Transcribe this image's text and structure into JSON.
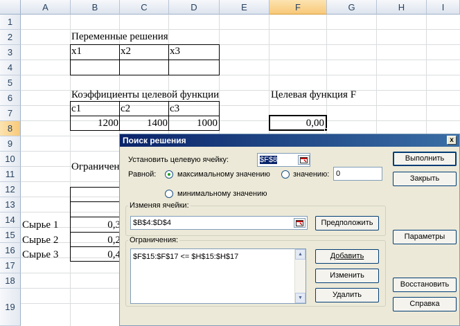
{
  "columns": [
    "A",
    "B",
    "C",
    "D",
    "E",
    "F",
    "G",
    "H",
    "I"
  ],
  "selected_column": "F",
  "rows": [
    "1",
    "2",
    "3",
    "4",
    "5",
    "6",
    "7",
    "8",
    "9",
    "10",
    "11",
    "12",
    "13",
    "14",
    "15",
    "16",
    "17",
    "18",
    "19"
  ],
  "selected_row": "8",
  "cells": {
    "b2": "Переменные решения",
    "b3": "x1",
    "c3": "x2",
    "d3": "x3",
    "b6": "Коэффициенты целевой функции",
    "f6": "Целевая функция F",
    "b7": "c1",
    "c7": "c2",
    "d7": "c3",
    "b8": "1200",
    "c8": "1400",
    "d8": "1000",
    "f8": "0,00",
    "b11": "Ограничен",
    "a15": "Сырье 1",
    "a16": "Сырье 2",
    "a17": "Сырье 3",
    "b15": "0,3",
    "b16": "0,2",
    "b17": "0,4"
  },
  "dialog": {
    "title": "Поиск решения",
    "close": "x",
    "target_label": "Установить целевую ячейку:",
    "target_value": "$F$8",
    "equal_label": "Равной:",
    "radio_max": "максимальному значению",
    "radio_value": "значению:",
    "value_field": "0",
    "radio_min": "минимальному значению",
    "changing_group": "Изменяя ячейки:",
    "changing_value": "$B$4:$D$4",
    "guess_button": "Предположить",
    "constraints_group": "Ограничения:",
    "constraints": [
      "$F$15:$F$17 <= $H$15:$H$17"
    ],
    "add_button": "Добавить",
    "change_button": "Изменить",
    "delete_button": "Удалить",
    "solve_button": "Выполнить",
    "close_button": "Закрыть",
    "options_button": "Параметры",
    "reset_button": "Восстановить",
    "help_button": "Справка"
  }
}
